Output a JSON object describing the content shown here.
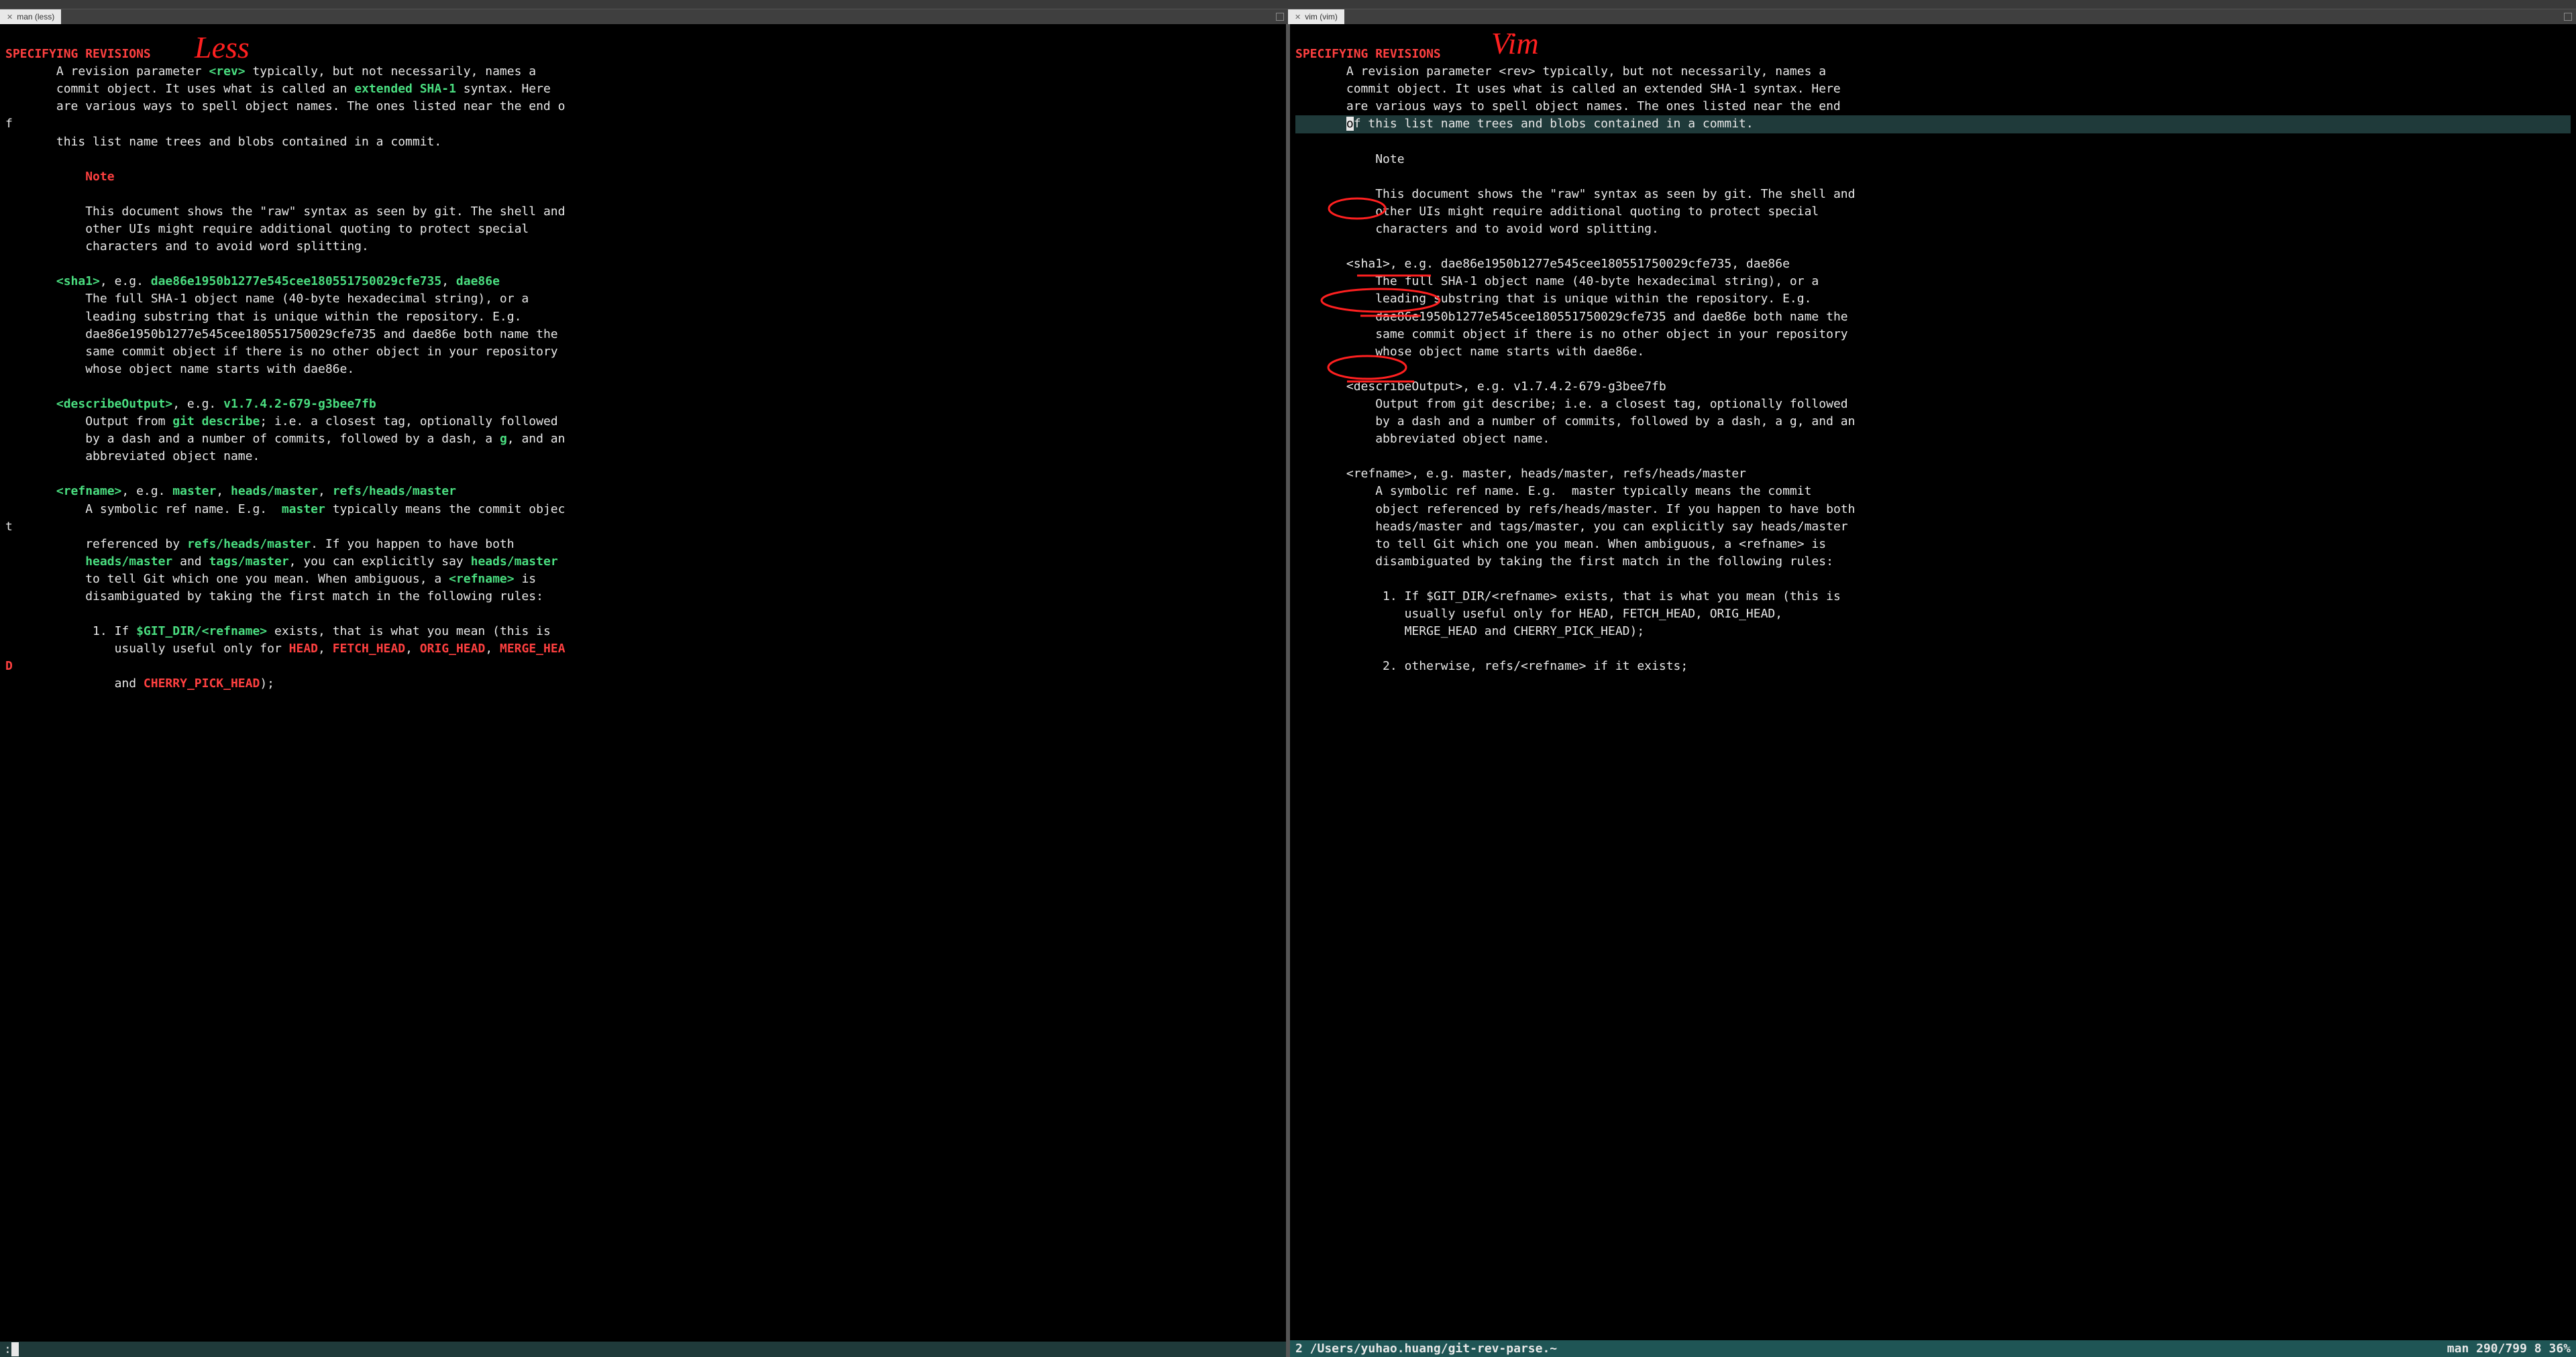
{
  "tabs": {
    "left": {
      "title": "man (less)"
    },
    "right": {
      "title": "vim (vim)"
    }
  },
  "annotations": {
    "less_label": "Less",
    "vim_label": "Vim"
  },
  "less": {
    "heading": "SPECIFYING REVISIONS",
    "intro_1a": "A revision parameter ",
    "intro_rev": "<rev>",
    "intro_1b": " typically, but not necessarily, names a",
    "intro_2a": "commit object. It uses what is called an ",
    "intro_ext": "extended SHA-1",
    "intro_2b": " syntax. Here",
    "intro_3": "are various ways to spell object names. The ones listed near the end o",
    "wrap_f": "f",
    "intro_4": "this list name trees and blobs contained in a commit.",
    "note": "Note",
    "note_body1": "This document shows the \"raw\" syntax as seen by git. The shell and",
    "note_body2": "other UIs might require additional quoting to protect special",
    "note_body3": "characters and to avoid word splitting.",
    "sha1_tag": "<sha1>",
    "sha1_eg": ", e.g. ",
    "sha1_long": "dae86e1950b1277e545cee180551750029cfe735",
    "sha1_sep": ", ",
    "sha1_short": "dae86e",
    "sha1_body1": "The full SHA-1 object name (40-byte hexadecimal string), or a",
    "sha1_body2": "leading substring that is unique within the repository. E.g.",
    "sha1_body3": "dae86e1950b1277e545cee180551750029cfe735 and dae86e both name the",
    "sha1_body4": "same commit object if there is no other object in your repository",
    "sha1_body5": "whose object name starts with dae86e.",
    "desc_tag": "<describeOutput>",
    "desc_eg": ", e.g. ",
    "desc_val": "v1.7.4.2-679-g3bee7fb",
    "desc_body1a": "Output from ",
    "desc_gitdesc": "git describe",
    "desc_body1b": "; i.e. a closest tag, optionally followed",
    "desc_body2a": "by a dash and a number of commits, followed by a dash, a ",
    "desc_g": "g",
    "desc_body2b": ", and an",
    "desc_body3": "abbreviated object name.",
    "ref_tag": "<refname>",
    "ref_eg": ", e.g. ",
    "ref_m1": "master",
    "ref_s1": ", ",
    "ref_m2": "heads/master",
    "ref_s2": ", ",
    "ref_m3": "refs/heads/master",
    "ref_body1a": "A symbolic ref name. E.g.  ",
    "ref_master": "master",
    "ref_body1b": " typically means the commit objec",
    "wrap_t": "t",
    "ref_body2a": "referenced by ",
    "ref_rhm": "refs/heads/master",
    "ref_body2b": ". If you happen to have both",
    "ref_hm": "heads/master",
    "ref_body3a": " and ",
    "ref_tm": "tags/master",
    "ref_body3b": ", you can explicitly say ",
    "ref_hm2": "heads/master",
    "ref_body4a": "to tell Git which one you mean. When ambiguous, a ",
    "ref_rn": "<refname>",
    "ref_body4b": " is",
    "ref_body5": "disambiguated by taking the first match in the following rules:",
    "rule1_a": " 1. If ",
    "rule1_gitdir": "$GIT_DIR/<refname>",
    "rule1_b": " exists, that is what you mean (this is",
    "rule1_c": "usually useful only for ",
    "rule1_head": "HEAD",
    "rule1_s1": ", ",
    "rule1_fetch": "FETCH_HEAD",
    "rule1_s2": ", ",
    "rule1_orig": "ORIG_HEAD",
    "rule1_s3": ", ",
    "rule1_merge": "MERGE_HEA",
    "wrap_d": "D",
    "rule1_and": "and ",
    "rule1_cherry": "CHERRY_PICK_HEAD",
    "rule1_end": ");",
    "prompt": ":"
  },
  "vim": {
    "heading": "SPECIFYING REVISIONS",
    "intro_1": "A revision parameter <rev> typically, but not necessarily, names a",
    "intro_2": "commit object. It uses what is called an extended SHA-1 syntax. Here",
    "intro_3": "are various ways to spell object names. The ones listed near the end",
    "intro_4_cur": "o",
    "intro_4_rest": "f this list name trees and blobs contained in a commit.",
    "note": "Note",
    "note_body1": "This document shows the \"raw\" syntax as seen by git. The shell and",
    "note_body2": "other UIs might require additional quoting to protect special",
    "note_body3": "characters and to avoid word splitting.",
    "sha1_line": "<sha1>, e.g. dae86e1950b1277e545cee180551750029cfe735, dae86e",
    "sha1_body1": "The full SHA-1 object name (40-byte hexadecimal string), or a",
    "sha1_body2": "leading substring that is unique within the repository. E.g.",
    "sha1_body3": "dae86e1950b1277e545cee180551750029cfe735 and dae86e both name the",
    "sha1_body4": "same commit object if there is no other object in your repository",
    "sha1_body5": "whose object name starts with dae86e.",
    "desc_line": "<describeOutput>, e.g. v1.7.4.2-679-g3bee7fb",
    "desc_body1": "Output from git describe; i.e. a closest tag, optionally followed",
    "desc_body2": "by a dash and a number of commits, followed by a dash, a g, and an",
    "desc_body3": "abbreviated object name.",
    "ref_line": "<refname>, e.g. master, heads/master, refs/heads/master",
    "ref_body1": "A symbolic ref name. E.g.  master typically means the commit",
    "ref_body2": "object referenced by refs/heads/master. If you happen to have both",
    "ref_body3": "heads/master and tags/master, you can explicitly say heads/master",
    "ref_body4": "to tell Git which one you mean. When ambiguous, a <refname> is",
    "ref_body5": "disambiguated by taking the first match in the following rules:",
    "rule1": " 1. If $GIT_DIR/<refname> exists, that is what you mean (this is",
    "rule1b": "    usually useful only for HEAD, FETCH_HEAD, ORIG_HEAD,",
    "rule1c": "    MERGE_HEAD and CHERRY_PICK_HEAD);",
    "rule2": " 2. otherwise, refs/<refname> if it exists;",
    "status_left": "  2 /Users/yuhao.huang/git-rev-parse.~",
    "status_right": "man 290/799 8 36%"
  }
}
